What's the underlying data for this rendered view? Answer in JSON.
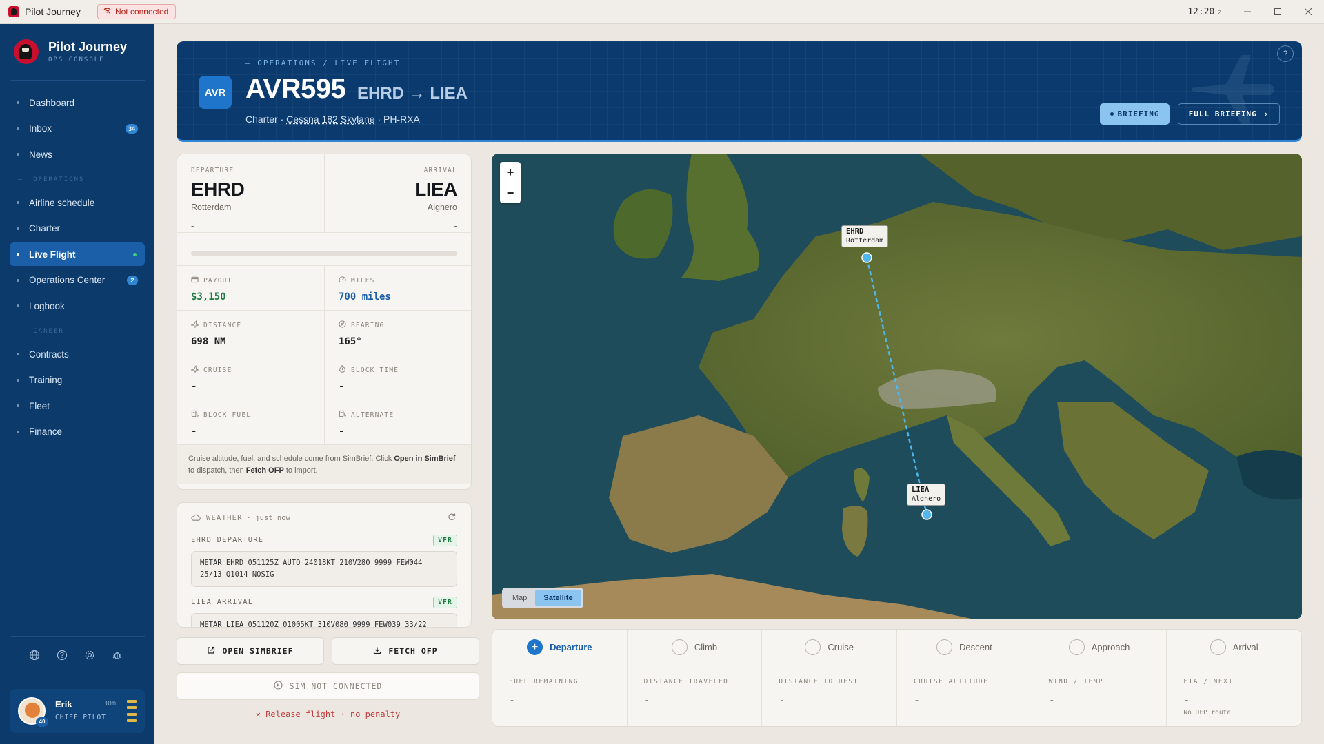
{
  "titlebar": {
    "app_name": "Pilot Journey",
    "connection_status": "Not connected",
    "clock": "12:20",
    "clock_zone": "z"
  },
  "sidebar": {
    "brand_title": "Pilot Journey",
    "brand_sub": "OPS CONSOLE",
    "items_top": [
      {
        "label": "Dashboard"
      },
      {
        "label": "Inbox",
        "count": "34"
      },
      {
        "label": "News"
      }
    ],
    "section_operations": "OPERATIONS",
    "items_ops": [
      {
        "label": "Airline schedule"
      },
      {
        "label": "Charter"
      },
      {
        "label": "Live Flight",
        "active": true
      },
      {
        "label": "Operations Center",
        "count": "2"
      },
      {
        "label": "Logbook"
      }
    ],
    "section_career": "CAREER",
    "items_career": [
      {
        "label": "Contracts"
      },
      {
        "label": "Training"
      },
      {
        "label": "Fleet"
      },
      {
        "label": "Finance"
      }
    ],
    "profile": {
      "name": "Erik",
      "time": "30m",
      "role": "CHIEF PILOT",
      "level": "40"
    }
  },
  "header": {
    "breadcrumb": "— OPERATIONS / LIVE FLIGHT",
    "airline_code": "AVR",
    "flight_number": "AVR595",
    "route": "EHRD → LIEA",
    "meta_type": "Charter · ",
    "meta_aircraft": "Cessna 182 Skylane",
    "meta_reg": " · PH-RXA",
    "briefing_label": "BRIEFING",
    "full_briefing_label": "FULL BRIEFING"
  },
  "flight_info": {
    "departure_label": "DEPARTURE",
    "departure_icao": "EHRD",
    "departure_city": "Rotterdam",
    "departure_time": "-",
    "arrival_label": "ARRIVAL",
    "arrival_icao": "LIEA",
    "arrival_city": "Alghero",
    "arrival_time": "-",
    "progress": 0,
    "stats": [
      {
        "label": "PAYOUT",
        "value": "$3,150",
        "icon": "wallet-icon"
      },
      {
        "label": "MILES",
        "value": "700 miles",
        "icon": "miles-icon"
      },
      {
        "label": "DISTANCE",
        "value": "698 NM",
        "icon": "plane-icon"
      },
      {
        "label": "BEARING",
        "value": "165°",
        "icon": "compass-icon"
      },
      {
        "label": "CRUISE",
        "value": "-",
        "icon": "plane-icon"
      },
      {
        "label": "BLOCK TIME",
        "value": "-",
        "icon": "stopwatch-icon"
      },
      {
        "label": "BLOCK FUEL",
        "value": "-",
        "icon": "fuel-icon"
      },
      {
        "label": "ALTERNATE",
        "value": "-",
        "icon": "fuel-icon"
      }
    ],
    "note_1": "Cruise altitude, fuel, and schedule come from SimBrief. Click ",
    "note_open": "Open in SimBrief",
    "note_2": " to dispatch, then ",
    "note_fetch": "Fetch OFP",
    "note_3": " to import."
  },
  "weather": {
    "title": "WEATHER",
    "updated": "· just now",
    "dep_label": "EHRD DEPARTURE",
    "dep_category": "VFR",
    "dep_metar": "METAR EHRD 051125Z AUTO 24018KT 210V280 9999 FEW044 25/13 Q1014 NOSIG",
    "arr_label": "LIEA ARRIVAL",
    "arr_category": "VFR",
    "arr_metar": "METAR LIEA 051120Z 01005KT 310V080 9999 FEW039 33/22"
  },
  "actions": {
    "open_simbrief": "OPEN SIMBRIEF",
    "fetch_ofp": "FETCH OFP",
    "sim_status": "SIM NOT CONNECTED",
    "release": "Release flight · no penalty"
  },
  "map": {
    "zoom_in": "+",
    "zoom_out": "−",
    "type_map": "Map",
    "type_satellite": "Satellite",
    "origin_icao": "EHRD",
    "origin_city": "Rotterdam",
    "dest_icao": "LIEA",
    "dest_city": "Alghero",
    "route_color": "#4fb6ee"
  },
  "phases": [
    {
      "label": "Departure",
      "active": true
    },
    {
      "label": "Climb"
    },
    {
      "label": "Cruise"
    },
    {
      "label": "Descent"
    },
    {
      "label": "Approach"
    },
    {
      "label": "Arrival"
    }
  ],
  "metrics": [
    {
      "label": "FUEL REMAINING",
      "value": "-"
    },
    {
      "label": "DISTANCE TRAVELED",
      "value": "-"
    },
    {
      "label": "DISTANCE TO DEST",
      "value": "-"
    },
    {
      "label": "CRUISE ALTITUDE",
      "value": "-"
    },
    {
      "label": "WIND / TEMP",
      "value": "-"
    },
    {
      "label": "ETA / NEXT",
      "value": "-",
      "sub": "No OFP route"
    }
  ],
  "colors": {
    "sidebar_bg": "#0b3a6b",
    "accent": "#2f86d6",
    "payout": "#1f7a45",
    "danger": "#c23a3a"
  }
}
